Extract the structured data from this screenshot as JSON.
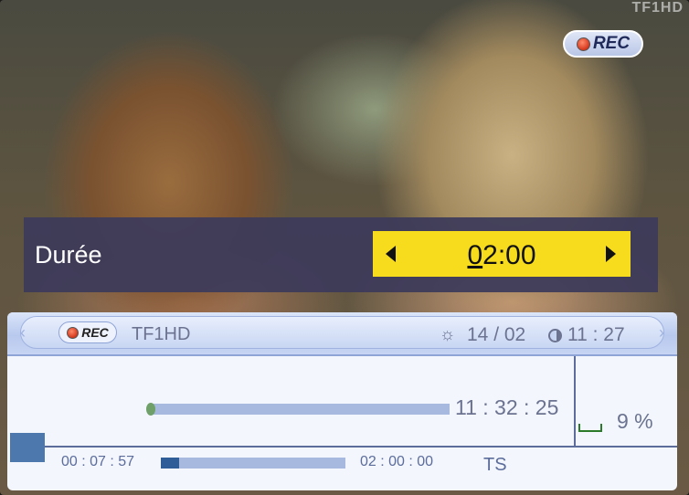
{
  "video": {
    "watermark": "TF1HD",
    "rec_badge": "REC"
  },
  "duration_dialog": {
    "label": "Durée",
    "value_hours": "0",
    "value_rest": "2:00"
  },
  "info_bar": {
    "rec_badge": "REC",
    "channel": "TF1HD",
    "date": "14 / 02",
    "time": "11 : 27",
    "recording_progress": 0.0,
    "recording_end": "11 : 32 : 25",
    "disk_usage": "9 %",
    "elapsed": "00 : 07 : 57",
    "total": "02 : 00 : 00",
    "playback_progress": 0.1,
    "mode": "TS"
  },
  "colors": {
    "panel": "#3c3a5a",
    "highlight": "#f6dc1c",
    "rec_red": "#d4361c",
    "progress": "#a8b9df",
    "progress_fill": "#2f5d97"
  },
  "icons": [
    "rec-dot-icon",
    "left-arrow-icon",
    "right-arrow-icon",
    "sun-icon",
    "clock-icon",
    "disk-icon",
    "stop-icon"
  ]
}
